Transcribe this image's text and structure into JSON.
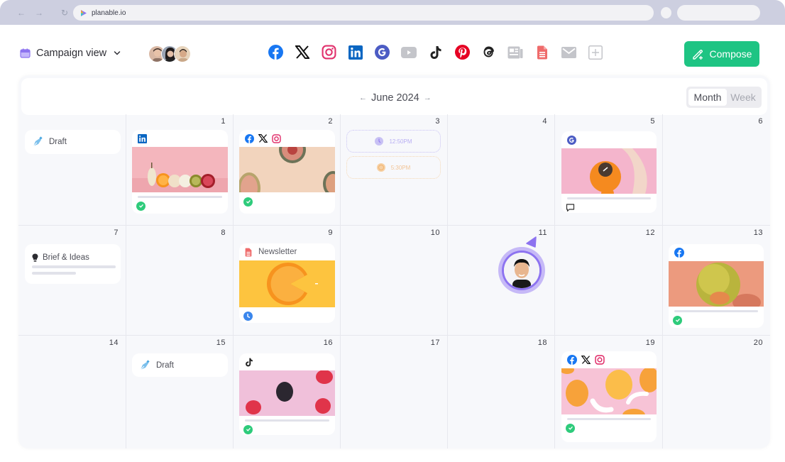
{
  "browser": {
    "url": "planable.io",
    "back_icon": "arrow-left-icon",
    "forward_icon": "arrow-right-icon",
    "reload_icon": "reload-icon"
  },
  "toolbar": {
    "view_label": "Campaign view",
    "view_icon": "calendar-icon",
    "compose_label": "Compose",
    "compose_color": "#1ec483",
    "channels": [
      {
        "name": "facebook",
        "color": "#1877f2"
      },
      {
        "name": "x",
        "color": "#111111"
      },
      {
        "name": "instagram",
        "color": "#e1306c"
      },
      {
        "name": "linkedin",
        "color": "#0a66c2"
      },
      {
        "name": "google-business",
        "color": "#4c5cc4"
      },
      {
        "name": "youtube",
        "color": "#c4c5ca"
      },
      {
        "name": "tiktok",
        "color": "#111111"
      },
      {
        "name": "pinterest",
        "color": "#e60023"
      },
      {
        "name": "threads",
        "color": "#111111"
      },
      {
        "name": "blog",
        "color": "#c4c5ca"
      },
      {
        "name": "document",
        "color": "#ef6b6b"
      },
      {
        "name": "email",
        "color": "#c4c5ca"
      },
      {
        "name": "add-channel",
        "color": "#c4c5ca"
      }
    ],
    "team_avatars": 3
  },
  "calendar": {
    "month_title": "June 2024",
    "prev_arrow": "←",
    "next_arrow": "→",
    "view_options": {
      "month": "Month",
      "week": "Week",
      "selected": "Month"
    },
    "days": [
      "",
      "1",
      "2",
      "3",
      "4",
      "5",
      "6",
      "7",
      "8",
      "9",
      "10",
      "11",
      "12",
      "13",
      "14",
      "15",
      "16",
      "17",
      "18",
      "19",
      "20"
    ],
    "notes": {
      "draft_label": "Draft",
      "brief_label": "Brief & Ideas",
      "newsletter_label": "Newsletter"
    },
    "time_slots": [
      {
        "time": "12:50PM",
        "color": "#b8aef3"
      },
      {
        "time": "5:30PM",
        "color": "#f2c496"
      }
    ],
    "posts": [
      {
        "day": "1",
        "channels": [
          "linkedin"
        ],
        "status": "approved"
      },
      {
        "day": "2",
        "channels": [
          "facebook",
          "x",
          "instagram"
        ],
        "status": "approved"
      },
      {
        "day": "5",
        "channels": [
          "google-business"
        ],
        "status": "comment"
      },
      {
        "day": "9",
        "channels": [
          "document"
        ],
        "status": "scheduled"
      },
      {
        "day": "13",
        "channels": [
          "facebook"
        ],
        "status": "approved"
      },
      {
        "day": "16",
        "channels": [
          "tiktok"
        ],
        "status": "approved"
      },
      {
        "day": "19",
        "channels": [
          "facebook",
          "x",
          "instagram"
        ],
        "status": "approved"
      }
    ]
  }
}
